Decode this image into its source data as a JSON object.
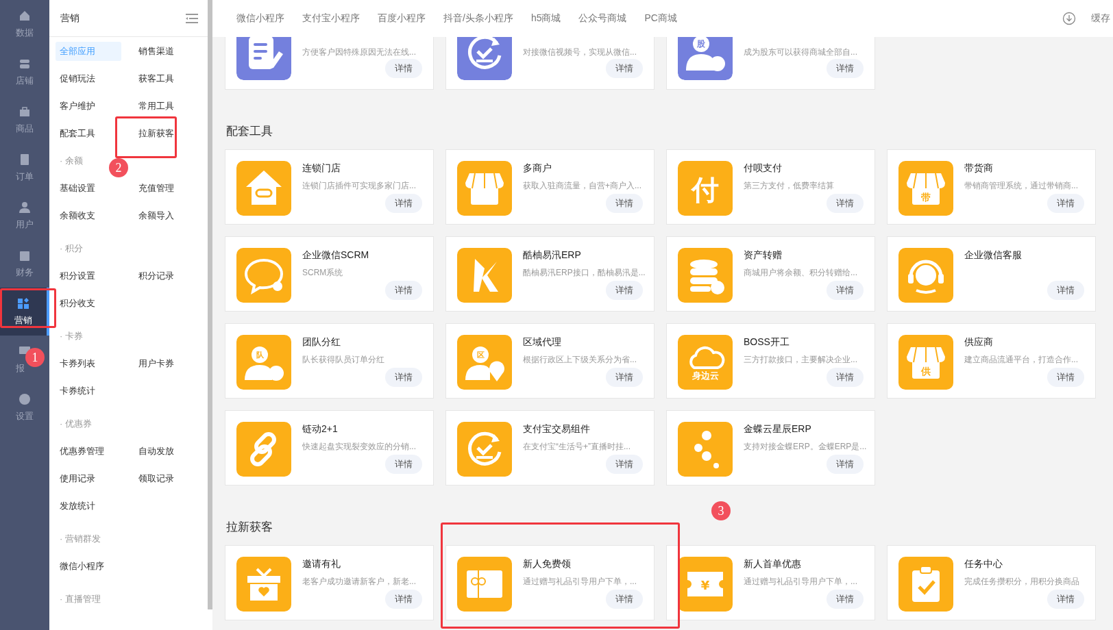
{
  "nav_rail": [
    {
      "label": "数据",
      "selected": false
    },
    {
      "label": "店铺",
      "selected": false
    },
    {
      "label": "商品",
      "selected": false
    },
    {
      "label": "订单",
      "selected": false
    },
    {
      "label": "用户",
      "selected": false
    },
    {
      "label": "财务",
      "selected": false
    },
    {
      "label": "营销",
      "selected": true
    },
    {
      "label": "报",
      "selected": false
    },
    {
      "label": "设置",
      "selected": false
    }
  ],
  "sidebar": {
    "title": "营销",
    "groups": [
      {
        "items": [
          {
            "label": "全部应用",
            "selected": true
          },
          {
            "label": "销售渠道",
            "selected": false
          },
          {
            "label": "促销玩法",
            "selected": false
          },
          {
            "label": "获客工具",
            "selected": false
          },
          {
            "label": "客户维护",
            "selected": false
          },
          {
            "label": "常用工具",
            "selected": false
          },
          {
            "label": "配套工具",
            "selected": false
          },
          {
            "label": "拉新获客",
            "selected": false
          }
        ]
      },
      {
        "title": "· 余额",
        "items": [
          {
            "label": "基础设置",
            "selected": false
          },
          {
            "label": "充值管理",
            "selected": false
          },
          {
            "label": "余额收支",
            "selected": false
          },
          {
            "label": "余额导入",
            "selected": false
          }
        ]
      },
      {
        "title": "· 积分",
        "items": [
          {
            "label": "积分设置",
            "selected": false
          },
          {
            "label": "积分记录",
            "selected": false
          },
          {
            "label": "积分收支",
            "selected": false
          }
        ]
      },
      {
        "title": "· 卡券",
        "items": [
          {
            "label": "卡券列表",
            "selected": false
          },
          {
            "label": "用户卡券",
            "selected": false
          },
          {
            "label": "卡券统计",
            "selected": false
          }
        ]
      },
      {
        "title": "· 优惠券",
        "items": [
          {
            "label": "优惠券管理",
            "selected": false
          },
          {
            "label": "自动发放",
            "selected": false
          },
          {
            "label": "使用记录",
            "selected": false
          },
          {
            "label": "领取记录",
            "selected": false
          },
          {
            "label": "发放统计",
            "selected": false
          }
        ]
      },
      {
        "title": "· 营销群发",
        "items": [
          {
            "label": "微信小程序",
            "selected": false
          }
        ]
      },
      {
        "title": "· 直播管理"
      }
    ]
  },
  "top_tabs": [
    "微信小程序",
    "支付宝小程序",
    "百度小程序",
    "抖音/头条小程序",
    "h5商城",
    "公众号商城",
    "PC商城"
  ],
  "top_right": {
    "label": "缓存"
  },
  "top_row_cards": [
    {
      "description": "方便客户因特殊原因无法在线...",
      "button": "详情"
    },
    {
      "description": "对接微信视频号，实现从微信...",
      "button": "详情"
    },
    {
      "icon_text": "股",
      "description": "成为股东可以获得商城全部自...",
      "button": "详情"
    }
  ],
  "sections": [
    {
      "title": "配套工具",
      "cards": [
        {
          "title": "连锁门店",
          "description": "连锁门店插件可实现多家门店...",
          "button": "详情"
        },
        {
          "title": "多商户",
          "description": "获取入驻商流量，自营+商户入...",
          "button": "详情"
        },
        {
          "icon_text": "付",
          "title": "付呗支付",
          "description": "第三方支付，低费率结算",
          "button": "详情"
        },
        {
          "icon_text": "带",
          "title": "带货商",
          "description": "带销商管理系统，通过带销商...",
          "button": "详情"
        },
        {
          "title": "企业微信SCRM",
          "description": "SCRM系统",
          "button": "详情"
        },
        {
          "title": "酷柚易汛ERP",
          "description": "酷柚易汛ERP接口，酷柚易汛是...",
          "button": "详情"
        },
        {
          "title": "资产转赠",
          "description": "商城用户将余额、积分转赠给...",
          "button": "详情"
        },
        {
          "title": "企业微信客服",
          "button": "详情"
        },
        {
          "icon_text": "队",
          "title": "团队分红",
          "description": "队长获得队员订单分红",
          "button": "详情"
        },
        {
          "icon_text": "区",
          "title": "区域代理",
          "description": "根据行政区上下级关系分为省...",
          "button": "详情"
        },
        {
          "icon_text": "身边云",
          "title": "BOSS开工",
          "description": "三方打款接口，主要解决企业...",
          "button": "详情"
        },
        {
          "icon_text": "供",
          "title": "供应商",
          "description": "建立商品流通平台，打造合作...",
          "button": "详情"
        },
        {
          "title": "链动2+1",
          "description": "快速起盘实现裂变效应的分销...",
          "button": "详情"
        },
        {
          "title": "支付宝交易组件",
          "description": "在支付宝“生活号+”直播时挂...",
          "button": "详情"
        },
        {
          "title": "金蝶云星辰ERP",
          "description": "支持对接金蝶ERP。金蝶ERP是...",
          "button": "详情"
        }
      ]
    },
    {
      "title": "拉新获客",
      "cards": [
        {
          "title": "邀请有礼",
          "description": "老客户成功邀请新客户，新老...",
          "button": "详情"
        },
        {
          "title": "新人免费领",
          "description": "通过赠与礼品引导用户下单，...",
          "button": "详情"
        },
        {
          "icon_text": "¥",
          "title": "新人首单优惠",
          "description": "通过赠与礼品引导用户下单，...",
          "button": "详情"
        },
        {
          "title": "任务中心",
          "description": "完成任务攒积分，用积分换商品",
          "button": "详情"
        }
      ]
    }
  ],
  "annotations": [
    {
      "kind": "box"
    },
    {
      "kind": "badge",
      "label": "1"
    },
    {
      "kind": "box"
    },
    {
      "kind": "badge",
      "label": "2"
    },
    {
      "kind": "box"
    },
    {
      "kind": "badge",
      "label": "3"
    }
  ]
}
